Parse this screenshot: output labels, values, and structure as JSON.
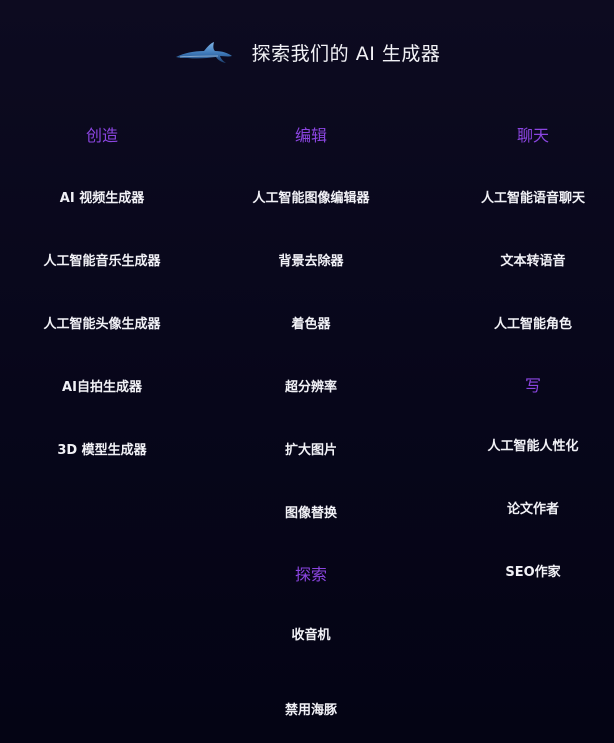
{
  "header": {
    "title": "探索我们的 AI 生成器",
    "logo_icon": "dolphin-icon"
  },
  "columns": [
    {
      "sections": [
        {
          "heading": "创造",
          "items": [
            "AI 视频生成器",
            "人工智能音乐生成器",
            "人工智能头像生成器",
            "AI自拍生成器",
            "3D 模型生成器"
          ]
        }
      ]
    },
    {
      "sections": [
        {
          "heading": "编辑",
          "items": [
            "人工智能图像编辑器",
            "背景去除器",
            "着色器",
            "超分辨率",
            "扩大图片",
            "图像替换"
          ]
        },
        {
          "heading": "探索",
          "items": [
            "收音机",
            "禁用海豚"
          ]
        }
      ]
    },
    {
      "sections": [
        {
          "heading": "聊天",
          "items": [
            "人工智能语音聊天",
            "文本转语音",
            "人工智能角色"
          ]
        },
        {
          "heading": "写",
          "items": [
            "人工智能人性化",
            "论文作者",
            "SEO作家"
          ]
        }
      ]
    }
  ],
  "colors": {
    "background": "#0b0a1c",
    "heading": "#8b45e0",
    "item": "#f1f1f6"
  }
}
